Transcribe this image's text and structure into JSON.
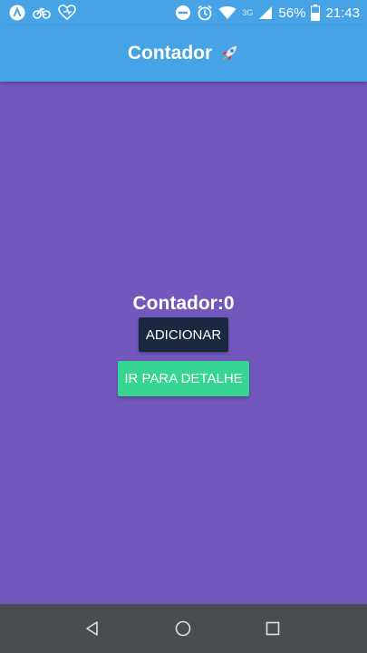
{
  "status_bar": {
    "network_type": "3G",
    "battery": "56%",
    "time": "21:43",
    "icons": [
      "app-a-icon",
      "bike-icon",
      "heart-icon",
      "do-not-disturb-icon",
      "alarm-icon",
      "wifi-icon",
      "signal-icon",
      "battery-icon"
    ]
  },
  "app_bar": {
    "title": "Contador",
    "title_icon": "rocket-icon"
  },
  "main": {
    "counter_label": "Contador:0",
    "add_button_label": "ADICIONAR",
    "detail_button_label": "IR PARA DETALHE"
  },
  "nav_bar": {
    "buttons": [
      "back-icon",
      "home-icon",
      "recents-icon"
    ]
  },
  "colors": {
    "app_bar": "#46a3e6",
    "background": "#7258bd",
    "add_button": "#1a2842",
    "detail_button": "#36d593",
    "nav_bar": "#4a4d50"
  }
}
